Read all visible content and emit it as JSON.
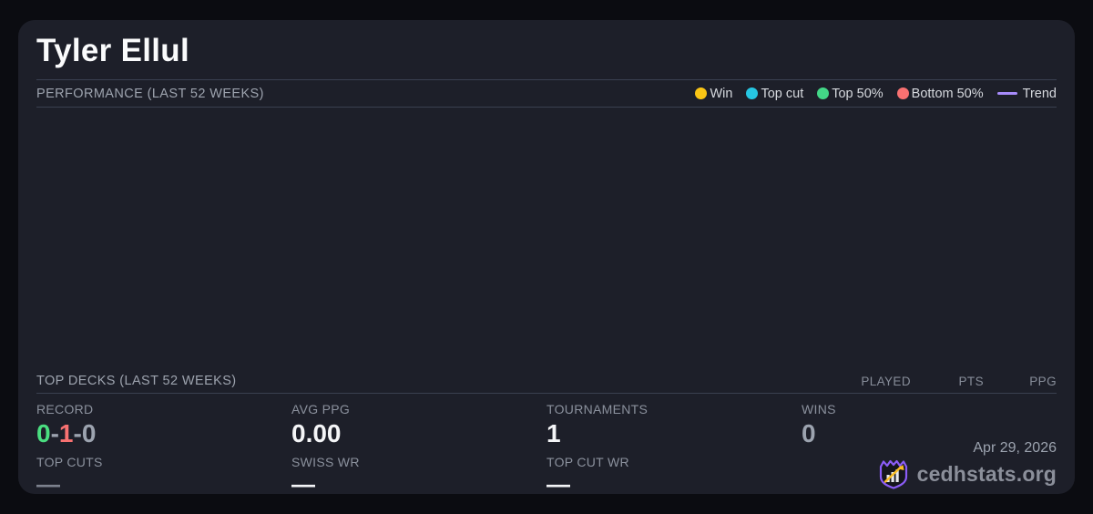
{
  "player": {
    "name": "Tyler Ellul"
  },
  "colors": {
    "green": "#4ade80",
    "red": "#f87171",
    "muted": "#9ca3af",
    "white": "#f4f5f7",
    "logo_purple": "#8b5cf6",
    "logo_yellow": "#fbbf24"
  },
  "performance": {
    "heading": "PERFORMANCE (LAST 52 WEEKS)",
    "legend": [
      {
        "label": "Win",
        "color": "#fac515",
        "swatch": "dot"
      },
      {
        "label": "Top cut",
        "color": "#26c6e2",
        "swatch": "dot"
      },
      {
        "label": "Top 50%",
        "color": "#43d787",
        "swatch": "dot"
      },
      {
        "label": "Bottom 50%",
        "color": "#f87171",
        "swatch": "dot"
      },
      {
        "label": "Trend",
        "color": "#a78bfa",
        "swatch": "line"
      }
    ],
    "chart_points": []
  },
  "top_decks": {
    "heading": "TOP DECKS (LAST 52 WEEKS)",
    "columns": [
      "PLAYED",
      "PTS",
      "PPG"
    ],
    "rows": []
  },
  "stats": {
    "record": {
      "label": "RECORD",
      "parts": [
        {
          "text": "0",
          "color": "#4ade80"
        },
        {
          "text": "-",
          "color": "#9ca3af"
        },
        {
          "text": "1",
          "color": "#f87171"
        },
        {
          "text": "-",
          "color": "#9ca3af"
        },
        {
          "text": "0",
          "color": "#9ca3af"
        }
      ]
    },
    "avg_ppg": {
      "label": "AVG PPG",
      "value": "0.00",
      "color": "#f4f5f7"
    },
    "tournaments": {
      "label": "TOURNAMENTS",
      "value": "1",
      "color": "#f4f5f7"
    },
    "wins": {
      "label": "WINS",
      "value": "0",
      "color": "#9ca3af"
    },
    "top_cuts": {
      "label": "TOP CUTS",
      "value": "—",
      "color": "#7d828e"
    },
    "swiss_wr": {
      "label": "SWISS WR",
      "value": "—",
      "color": "#f4f5f7"
    },
    "top_cut_wr": {
      "label": "TOP CUT WR",
      "value": "—",
      "color": "#f4f5f7"
    }
  },
  "footer": {
    "date": "Apr 29, 2026",
    "brand": "cedhstats.org"
  }
}
